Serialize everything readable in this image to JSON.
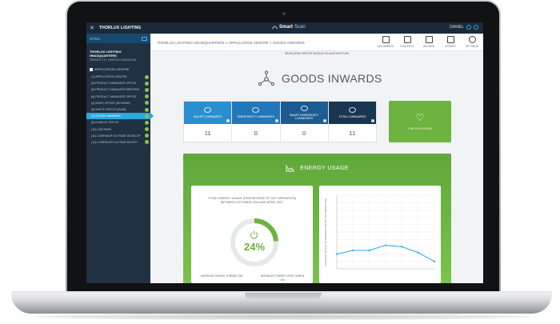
{
  "topbar": {
    "close_glyph": "✕",
    "brand": "THORLUX LIGHTING",
    "product_prefix": "Smart",
    "product_suffix": "Scan",
    "user": "DANIEL"
  },
  "sidebar": {
    "header": "SITES",
    "company": "THORLUX LIGHTING HEADQUARTERS",
    "company_location": "REDDITCH, UNITED KINGDOM",
    "site_label": "APPLICATION CENTRE",
    "items": [
      {
        "label": "(1) APPLICATION CENTRE",
        "active": false
      },
      {
        "label": "(6) PRODUCT MANAGER OFFICE",
        "active": false
      },
      {
        "label": "(6) PRODUCT MANAGER BRIEFING",
        "active": false
      },
      {
        "label": "(6) PRODUCT MANAGER OFFICE",
        "active": false
      },
      {
        "label": "(3) MAPS OFFICE (MOVEME)",
        "active": false
      },
      {
        "label": "(6) WHITE OFFICE (MAIN)",
        "active": false
      },
      {
        "label": "(7) GOODS INWARDS",
        "active": true
      },
      {
        "label": "(8) HUNDLE OFFICE",
        "active": false
      },
      {
        "label": "(10) CAR PARK",
        "active": false
      },
      {
        "label": "(11) CORRIDOR OUTSIDE DEVELOP",
        "active": false
      },
      {
        "label": "(12) CORRIDOR OUTSIDE BOOTH",
        "active": false
      }
    ]
  },
  "breadcrumb": "THORLUX LIGHTING HEADQUARTERS  >  APPLICATION CENTRE  >  GOODS INWARDS",
  "tools": [
    {
      "label": "DOCUMENTS",
      "icon": "documents-icon"
    },
    {
      "label": "CONTRACT",
      "icon": "contract-icon"
    },
    {
      "label": "ARCHIVE",
      "icon": "archive-icon"
    },
    {
      "label": "EXPORT",
      "icon": "export-icon"
    },
    {
      "label": "SETTINGS",
      "icon": "settings-icon"
    }
  ],
  "notice": "DEVELOPING REPORT MODULE AS ANOTHER PLAN",
  "page_title": "GOODS INWARDS",
  "kpis": [
    {
      "label": "SMART LUMINAIRES",
      "value": "11",
      "color": "#2a8fd0"
    },
    {
      "label": "EMERGENCY LUMINAIRES",
      "value": "0",
      "color": "#2277b8"
    },
    {
      "label": "SMART EMERGENCY LUMINAIRES",
      "value": "0",
      "color": "#1d5c93"
    },
    {
      "label": "TOTAL LUMINAIRES",
      "value": "11",
      "color": "#183650"
    }
  ],
  "notifications_label": "0 NOTIFICATIONS",
  "energy": {
    "title": "ENERGY USAGE",
    "card_caption_line1": "TOTAL ENERGY USAGE (PERCENTAGE OF 24/7 OPERATION)",
    "card_caption_line2": "BETWEEN OCTOBER 2016 AND APRIL 2017",
    "percent_value": 24,
    "percent_text": "24%",
    "footer_left": "AVERAGE HOURS TURNED ON",
    "footer_right": "AVERAGE POWER LEVEL WHEN ON",
    "accent": "#6cb33f"
  },
  "chart_data": {
    "type": "line",
    "ylabel": "AVERAGE HOURS ON (PERCENTAGE OF 24/7 OPERATION)",
    "y": [
      20,
      25,
      25,
      32,
      30,
      22,
      10
    ],
    "ylim": [
      0,
      100
    ],
    "grid": true
  }
}
